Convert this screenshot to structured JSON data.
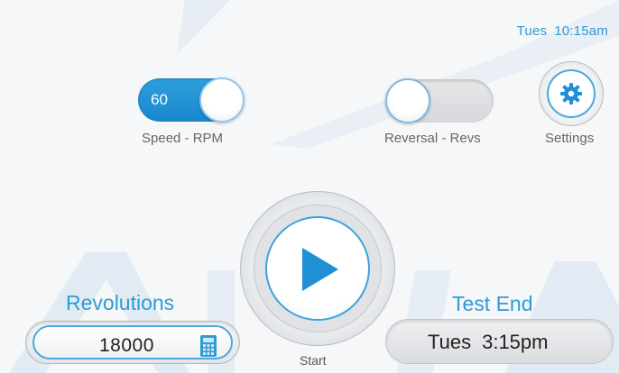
{
  "status": {
    "day": "Tues",
    "time": "10:15am"
  },
  "speed": {
    "value": "60",
    "label": "Speed - RPM",
    "state": "on"
  },
  "reversal": {
    "label": "Reversal - Revs",
    "state": "off"
  },
  "settings": {
    "label": "Settings",
    "icon": "gear-icon"
  },
  "start": {
    "label": "Start",
    "icon": "play-icon"
  },
  "revolutions": {
    "title": "Revolutions",
    "value": "18000",
    "icon": "calculator-icon"
  },
  "test_end": {
    "title": "Test End",
    "day": "Tues",
    "time": "3:15pm"
  },
  "colors": {
    "accent": "#2f9bd6",
    "background": "#f6f7f8",
    "watermark": "#dfe9f2"
  }
}
